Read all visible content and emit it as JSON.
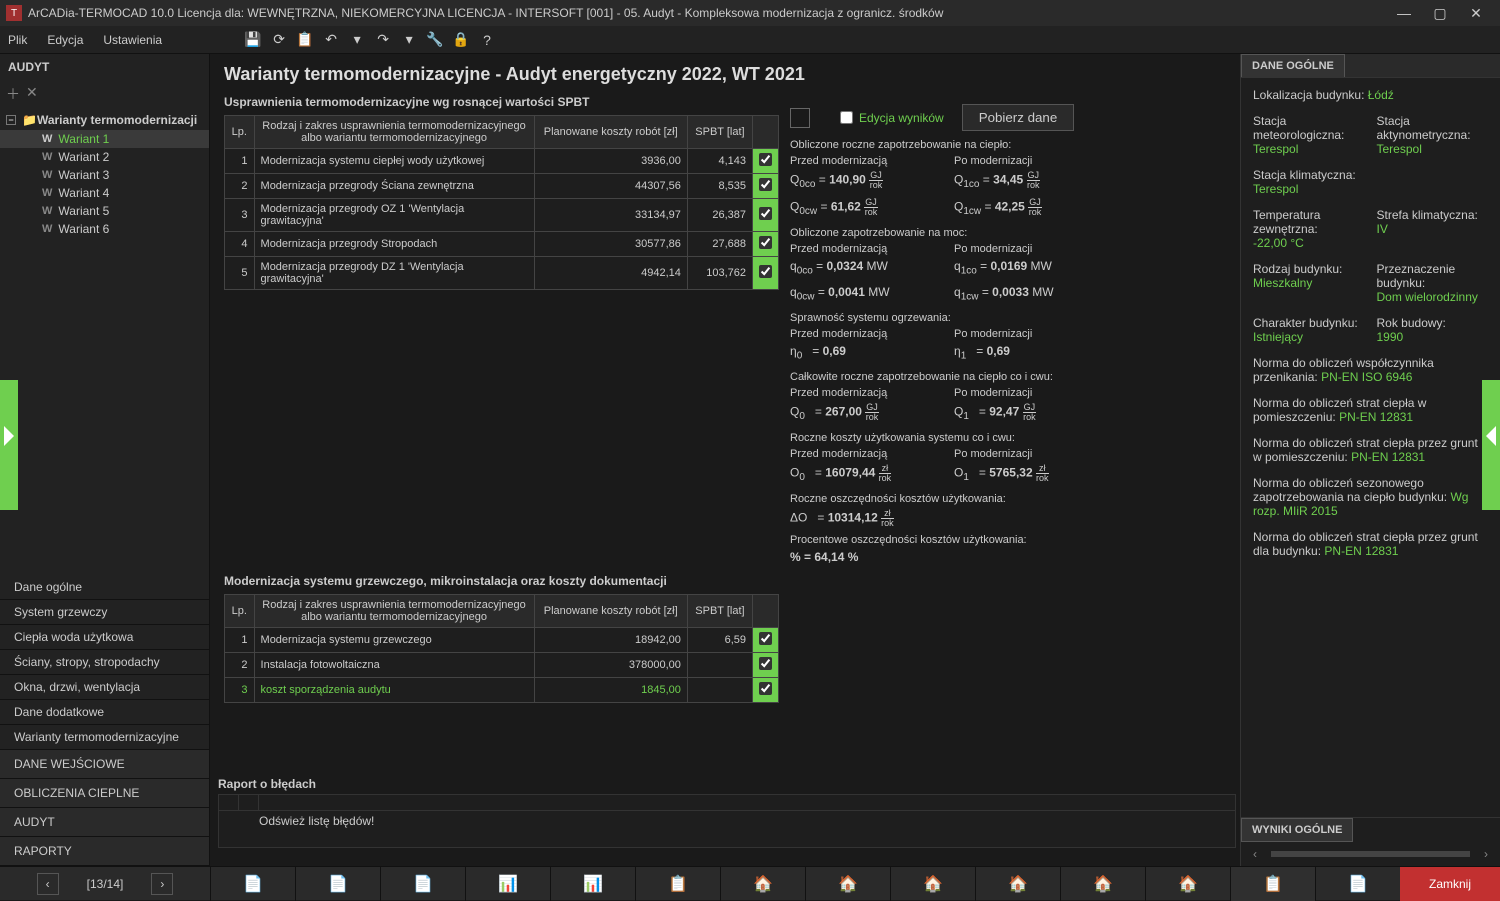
{
  "title": "ArCADia-TERMOCAD 10.0 Licencja dla: WEWNĘTRZNA, NIEKOMERCYJNA LICENCJA - INTERSOFT [001] - 05. Audyt - Kompleksowa modernizacja z ogranicz. środków",
  "menu": {
    "file": "Plik",
    "edit": "Edycja",
    "settings": "Ustawienia"
  },
  "left_head": "AUDYT",
  "tree_root": "Warianty termomodernizacji",
  "variants": [
    "Wariant 1",
    "Wariant 2",
    "Wariant 3",
    "Wariant 4",
    "Wariant 5",
    "Wariant 6"
  ],
  "nav": [
    "Dane ogólne",
    "System grzewczy",
    "Ciepła woda użytkowa",
    "Ściany, stropy, stropodachy",
    "Okna, drzwi, wentylacja",
    "Dane dodatkowe",
    "Warianty termomodernizacyjne"
  ],
  "nav_sect": [
    "DANE WEJŚCIOWE",
    "OBLICZENIA CIEPLNE",
    "AUDYT",
    "RAPORTY"
  ],
  "page_title": "Warianty termomodernizacyjne - Audyt energetyczny 2022, WT 2021",
  "table1": {
    "caption": "Usprawnienia termomodernizacyjne wg rosnącej wartości SPBT",
    "cols": [
      "Lp.",
      "Rodzaj i zakres usprawnienia termomodernizacyjnego albo wariantu termomodernizacyjnego",
      "Planowane koszty robót [zł]",
      "SPBT [lat]",
      ""
    ],
    "rows": [
      [
        "1",
        "Modernizacja systemu ciepłej wody użytkowej",
        "3936,00",
        "4,143"
      ],
      [
        "2",
        "Modernizacja przegrody Ściana zewnętrzna",
        "44307,56",
        "8,535"
      ],
      [
        "3",
        "Modernizacja przegrody OZ 1 'Wentylacja grawitacyjna'",
        "33134,97",
        "26,387"
      ],
      [
        "4",
        "Modernizacja przegrody Stropodach",
        "30577,86",
        "27,688"
      ],
      [
        "5",
        "Modernizacja przegrody DZ 1 'Wentylacja grawitacyjna'",
        "4942,14",
        "103,762"
      ]
    ]
  },
  "table2": {
    "caption": "Modernizacja systemu grzewczego, mikroinstalacja oraz koszty dokumentacji",
    "cols": [
      "Lp.",
      "Rodzaj i zakres usprawnienia termomodernizacyjnego albo wariantu termomodernizacyjnego",
      "Planowane koszty robót [zł]",
      "SPBT [lat]",
      ""
    ],
    "rows": [
      [
        "1",
        "Modernizacja systemu grzewczego",
        "18942,00",
        "6,59"
      ],
      [
        "2",
        "Instalacja fotowoltaiczna",
        "378000,00",
        ""
      ],
      [
        "3",
        "koszt sporządzenia audytu",
        "1845,00",
        ""
      ]
    ]
  },
  "calc": {
    "edit_label": "Edycja wyników",
    "fetch_btn": "Pobierz dane",
    "heat_demand": "Obliczone roczne zapotrzebowanie na ciepło:",
    "before": "Przed modernizacją",
    "after": "Po modernizacji",
    "Q0co": "140,90",
    "Q1co": "34,45",
    "Q0cw": "61,62",
    "Q1cw": "42,25",
    "power_demand": "Obliczone zapotrzebowanie na moc:",
    "q0co": "0,0324",
    "q1co": "0,0169",
    "q0cw": "0,0041",
    "q1cw": "0,0033",
    "MW": "MW",
    "eff_head": "Sprawność systemu ogrzewania:",
    "eta0": "0,69",
    "eta1": "0,69",
    "total_head": "Całkowite roczne zapotrzebowanie na ciepło co i cwu:",
    "Q0": "267,00",
    "Q1": "92,47",
    "cost_head": "Roczne koszty użytkowania systemu co i cwu:",
    "O0": "16079,44",
    "O1": "5765,32",
    "savings_head": "Roczne oszczędności kosztów użytkowania:",
    "dO": "10314,12",
    "pct_head": "Procentowe oszczędności kosztów użytkowania:",
    "pct": "% = 64,14  %"
  },
  "right": {
    "tab": "DANE OGÓLNE",
    "loc_l": "Lokalizacja budynku:",
    "loc_v": "Łódź",
    "meteo_l": "Stacja meteorologiczna:",
    "meteo_v": "Terespol",
    "act_l": "Stacja aktynometryczna:",
    "act_v": "Terespol",
    "klim_l": "Stacja klimatyczna:",
    "klim_v": "Terespol",
    "temp_l": "Temperatura zewnętrzna:",
    "temp_v": "-22,00 °C",
    "zone_l": "Strefa klimatyczna:",
    "zone_v": "IV",
    "type_l": "Rodzaj budynku:",
    "type_v": "Mieszkalny",
    "dest_l": "Przeznaczenie budynku:",
    "dest_v": "Dom wielorodzinny",
    "char_l": "Charakter budynku:",
    "char_v": "Istniejący",
    "year_l": "Rok budowy:",
    "year_v": "1990",
    "n1_l": "Norma do obliczeń współczynnika przenikania:",
    "n1_v": "PN-EN ISO 6946",
    "n2_l": "Norma do obliczeń strat ciepła w pomieszczeniu:",
    "n2_v": "PN-EN 12831",
    "n3_l": "Norma do obliczeń strat ciepła przez grunt w pomieszczeniu:",
    "n3_v": "PN-EN 12831",
    "n4_l": "Norma do obliczeń sezonowego zapotrzebowania na ciepło budynku:",
    "n4_v": "Wg rozp. MIiR 2015",
    "n5_l": "Norma do obliczeń strat ciepła przez grunt dla budynku:",
    "n5_v": "PN-EN 12831",
    "tab2": "WYNIKI OGÓLNE"
  },
  "error": {
    "head": "Raport o błędach",
    "msg": "Odśwież listę błędów!"
  },
  "pager": "[13/14]",
  "close_btn": "Zamknij"
}
